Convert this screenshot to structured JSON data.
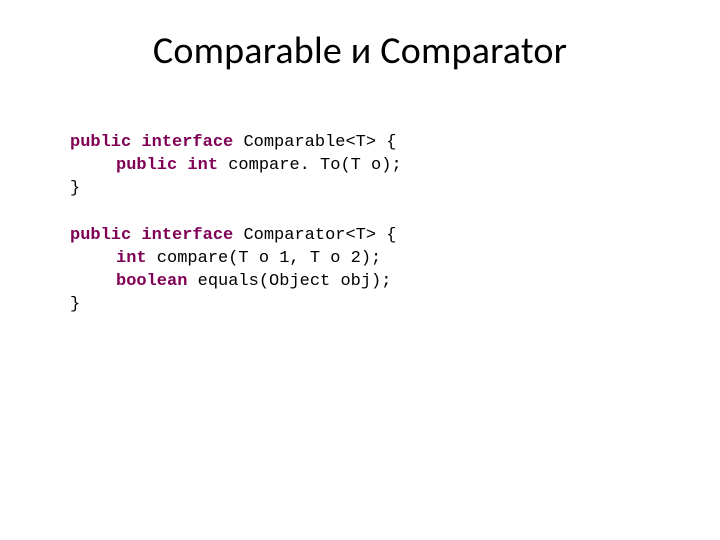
{
  "title": "Comparable и Comparator",
  "block1": {
    "l1_kw1": "public",
    "l1_kw2": "interface",
    "l1_rest": " Comparable<T> {",
    "l2_kw1": "public",
    "l2_kw2": "int",
    "l2_rest": " compare. To(T o);",
    "l3": "}"
  },
  "block2": {
    "l1_kw1": "public",
    "l1_kw2": "interface",
    "l1_rest": " Comparator<T> {",
    "l2_kw1": "int",
    "l2_rest": " compare(T o 1, T o 2);",
    "l3_kw1": "boolean",
    "l3_rest": " equals(Object obj);",
    "l4": "}"
  }
}
